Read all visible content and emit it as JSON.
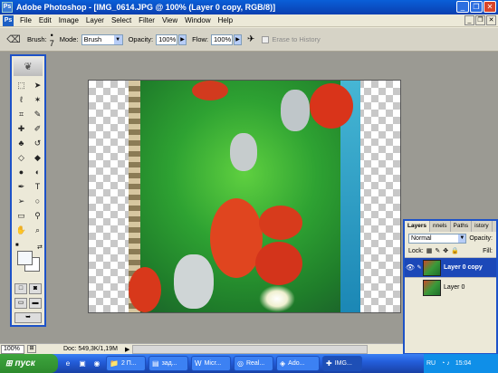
{
  "window": {
    "title": "Adobe Photoshop - [IMG_0614.JPG @ 100% (Layer 0 copy, RGB/8)]",
    "icon": "photoshop-icon"
  },
  "menu": [
    "File",
    "Edit",
    "Image",
    "Layer",
    "Select",
    "Filter",
    "View",
    "Window",
    "Help"
  ],
  "options": {
    "brush_label": "Brush:",
    "brush_size": "7",
    "mode_label": "Mode:",
    "mode_value": "Brush",
    "opacity_label": "Opacity:",
    "opacity_value": "100%",
    "flow_label": "Flow:",
    "flow_value": "100%",
    "erase_to_history": "Erase to History"
  },
  "layers_panel": {
    "tabs": [
      "Layers",
      "nnels",
      "Paths",
      "istory"
    ],
    "blend_mode": "Normal",
    "opacity_label": "Opacity:",
    "lock_label": "Lock:",
    "fill_label": "Fill:",
    "layers": [
      {
        "name": "Layer 0 copy",
        "selected": true
      },
      {
        "name": "Layer 0",
        "selected": false
      }
    ]
  },
  "status": {
    "zoom": "100%",
    "doc": "Doc: 549,3K/1,19M"
  },
  "taskbar": {
    "start": "пуск",
    "tasks": [
      {
        "label": "2 П...",
        "icon": "folder-icon"
      },
      {
        "label": "зад...",
        "icon": "document-icon"
      },
      {
        "label": "Micr...",
        "icon": "word-icon"
      },
      {
        "label": "Real...",
        "icon": "realplayer-icon"
      },
      {
        "label": "Ado...",
        "icon": "adobe-icon"
      },
      {
        "label": "IMG...",
        "icon": "image-icon"
      }
    ],
    "language": "RU",
    "clock": "15:04"
  }
}
